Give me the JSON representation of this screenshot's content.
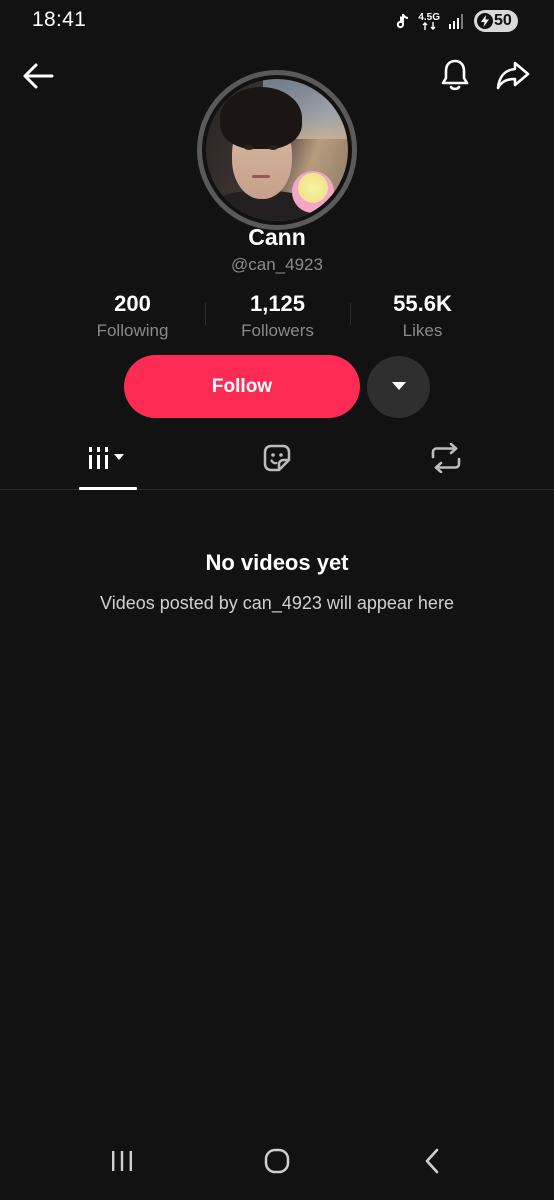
{
  "status_bar": {
    "time": "18:41",
    "network_type": "4.5G",
    "battery_level": "50",
    "icons": [
      "tiktok-note-icon",
      "network-arrows-icon",
      "signal-bars-icon",
      "charging-bolt-icon"
    ]
  },
  "header": {
    "icons": [
      "back-arrow-icon",
      "bell-icon",
      "share-icon"
    ]
  },
  "profile": {
    "display_name": "Cann",
    "handle": "@can_4923",
    "avatar_ring_color": "#5a5a5a"
  },
  "stats": [
    {
      "value": "200",
      "label": "Following"
    },
    {
      "value": "1,125",
      "label": "Followers"
    },
    {
      "value": "55.6K",
      "label": "Likes"
    }
  ],
  "actions": {
    "follow_label": "Follow",
    "follow_color": "#fe2c55",
    "more_icon": "caret-down-icon"
  },
  "tabs": [
    {
      "icon": "videos-grid-icon",
      "selected": true
    },
    {
      "icon": "sticker-icon",
      "selected": false
    },
    {
      "icon": "repost-icon",
      "selected": false
    }
  ],
  "empty_state": {
    "title": "No videos yet",
    "subtitle": "Videos posted by can_4923 will appear here"
  },
  "nav_bar": {
    "icons": [
      "recents-icon",
      "home-icon",
      "nav-back-icon"
    ]
  },
  "colors": {
    "background": "#121212",
    "secondary_text": "#8a8a8a",
    "accent": "#fe2c55"
  }
}
